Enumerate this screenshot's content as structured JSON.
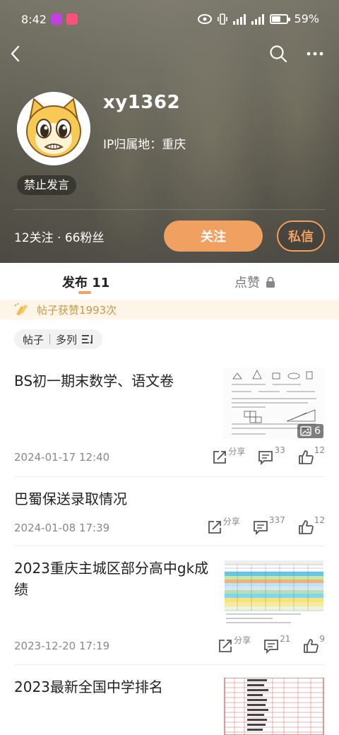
{
  "status": {
    "time": "8:42",
    "battery": "59%",
    "signal1": "5G",
    "signal2": "5G"
  },
  "profile": {
    "username": "xy1362",
    "ip_location": "IP归属地：重庆",
    "banned_badge": "禁止发言",
    "follows_text": "12关注 · 66粉丝",
    "follow_label": "关注",
    "message_label": "私信"
  },
  "tabs": {
    "posts_label": "发布 11",
    "likes_label": "点赞"
  },
  "likes_banner": "帖子获赞1993次",
  "filter": {
    "type_label": "帖子",
    "view_label": "多列"
  },
  "posts": [
    {
      "title": "BS初一期末数学、语文卷",
      "date": "2024-01-17 12:40",
      "share": "分享",
      "comments": "33",
      "likes": "12",
      "image_count": "6"
    },
    {
      "title": "巴蜀保送录取情况",
      "date": "2024-01-08 17:39",
      "share": "分享",
      "comments": "337",
      "likes": "12"
    },
    {
      "title": "2023重庆主城区部分高中gk成绩",
      "date": "2023-12-20 17:19",
      "share": "分享",
      "comments": "21",
      "likes": "9"
    },
    {
      "title": "2023最新全国中学排名"
    }
  ],
  "colors": {
    "accent": "#f0a060",
    "banner_bg": "#fdf5e8",
    "banner_text": "#c59a4a"
  }
}
